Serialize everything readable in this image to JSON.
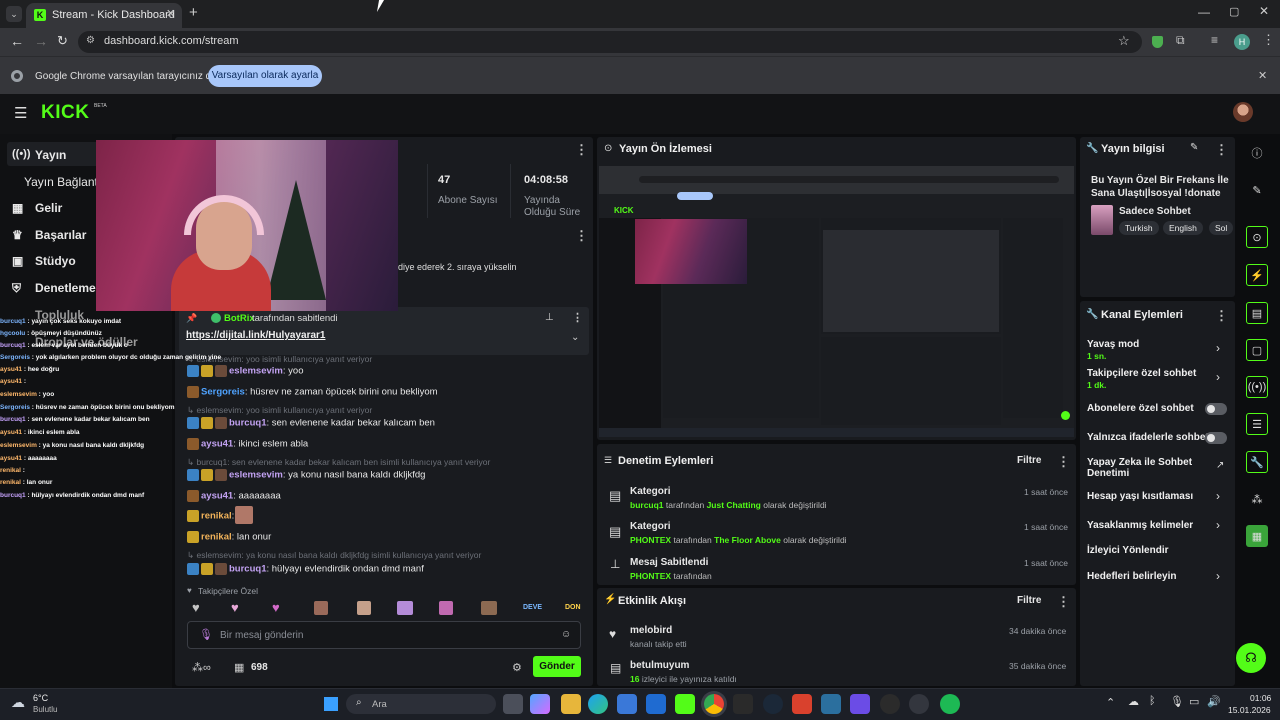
{
  "browser": {
    "tab_title": "Stream - Kick Dashboard",
    "url": "dashboard.kick.com/stream",
    "profile_letter": "H",
    "infobar_text": "Google Chrome varsayılan tarayıcınız değil",
    "infobar_button": "Varsayılan olarak ayarla"
  },
  "site": {
    "logo": "KICK",
    "logo_sup": "BETA"
  },
  "nav": {
    "items": [
      "Yayın",
      "Yayın Bağlantı",
      "Gelir",
      "Başarılar",
      "Stüdyo",
      "Denetleme",
      "Topluluk",
      "Droplar ve ödüller"
    ]
  },
  "stats": {
    "subs_value": "47",
    "subs_label": "Abone Sayısı",
    "uptime_value": "04:08:58",
    "uptime_label": "Yayında Olduğu Süre"
  },
  "chat": {
    "truncated_top": "diye ederek 2. sıraya yükselin",
    "pinned_by_user": "BotRix",
    "pinned_by_suffix": "tarafından sabitlendi",
    "pinned_link": "https://dijital.link/Hulyayarar1",
    "messages": [
      {
        "reply": "eslemsevim: yoo isimli kullanıcıya yanıt veriyor",
        "user": "eslemsevim",
        "text": "yoo"
      },
      {
        "reply": "",
        "user": "Sergoreis",
        "text": "hüsrev ne zaman öpücek birini onu bekliyom"
      },
      {
        "reply": "eslemsevim: yoo isimli kullanıcıya yanıt veriyor",
        "user": "burcuq1",
        "text": "sen evlenene kadar bekar kalıcam ben"
      },
      {
        "reply": "",
        "user": "aysu41",
        "text": "ikinci eslem abla"
      },
      {
        "reply": "burcuq1: sen evlenene kadar bekar kalıcam ben isimli kullanıcıya yanıt veriyor",
        "user": "eslemsevim",
        "text": "ya konu nasıl bana kaldı dkljkfdg"
      },
      {
        "reply": "",
        "user": "aysu41",
        "text": "aaaaaaaa"
      },
      {
        "reply": "",
        "user": "renikal",
        "text": ""
      },
      {
        "reply": "",
        "user": "renikal",
        "text": "lan onur"
      },
      {
        "reply": "eslemsevim: ya konu nasıl bana kaldı dkljkfdg isimli kullanıcıya yanıt veriyor",
        "user": "burcuq1",
        "text": "hülyayı evlendirdik ondan dmd manf"
      }
    ],
    "followers_only": "Takipçilere Özel",
    "emote_labels": [
      "DEVE",
      "DON"
    ],
    "input_placeholder": "Bir mesaj gönderin",
    "viewer_count": "698",
    "send_label": "Gönder"
  },
  "overlay_chat": [
    {
      "user": "burcuq1",
      "text": "yayın çok seks kokuyo imdat"
    },
    {
      "user": "hgcoolu",
      "text": "öpüşmeyi düşündünüz"
    },
    {
      "user": "burcuq1",
      "text": "eslem var ayol benden büyük o"
    },
    {
      "user": "Sergoreis",
      "text": "yok algılarken problem oluyor dc olduğu zaman gelirim yine"
    },
    {
      "user": "aysu41",
      "text": "hee doğru"
    },
    {
      "user": "aysu41",
      "text": ""
    },
    {
      "user": "eslemsevim",
      "text": "yoo"
    },
    {
      "user": "Sergoreis",
      "text": "hüsrev ne zaman öpücek birini onu bekliyom"
    },
    {
      "user": "burcuq1",
      "text": "sen evlenene kadar bekar kalıcam ben"
    },
    {
      "user": "aysu41",
      "text": "ikinci eslem abla"
    },
    {
      "user": "eslemsevim",
      "text": "ya konu nasıl bana kaldı dkljkfdg"
    },
    {
      "user": "aysu41",
      "text": "aaaaaaaa"
    },
    {
      "user": "renikal",
      "text": ""
    },
    {
      "user": "renikal",
      "text": "lan onur"
    },
    {
      "user": "burcuq1",
      "text": "hülyayı evlendirdik ondan dmd manf"
    }
  ],
  "preview": {
    "title": "Yayın Ön İzlemesi"
  },
  "moderation": {
    "title": "Denetim Eylemleri",
    "filter": "Filtre",
    "rows": [
      {
        "title": "Kategori",
        "actor": "burcuq1",
        "mid": "tarafından",
        "target": "Just Chatting",
        "end": "olarak değiştirildi",
        "time": "1 saat önce"
      },
      {
        "title": "Kategori",
        "actor": "PHONTEX",
        "mid": "tarafından",
        "target": "The Floor Above",
        "end": "olarak değiştirildi",
        "time": "1 saat önce"
      },
      {
        "title": "Mesaj Sabitlendi",
        "actor": "PHONTEX",
        "mid": "tarafından",
        "target": "",
        "end": "",
        "time": "1 saat önce"
      }
    ]
  },
  "activity": {
    "title": "Etkinlik Akışı",
    "filter": "Filtre",
    "rows": [
      {
        "user": "melobird",
        "text": "kanalı takip etti",
        "time": "34 dakika önce"
      },
      {
        "user": "betulmuyum",
        "text": "izleyici ile yayınıza katıldı",
        "count": "16",
        "time": "35 dakika önce"
      }
    ]
  },
  "stream_info": {
    "title": "Yayın bilgisi",
    "stream_title": "Bu Yayın Özel Bir Frekans İle Sana Ulaştı|İsosyal !donate",
    "category": "Sadece Sohbet",
    "tags": [
      "Turkish",
      "English",
      "Sol"
    ]
  },
  "channel_actions": {
    "title": "Kanal Eylemleri",
    "slow_mode": "Yavaş mod",
    "slow_mode_value": "1 sn.",
    "followers_chat": "Takipçilere özel sohbet",
    "followers_chat_value": "1 dk.",
    "subs_chat": "Abonelere özel sohbet",
    "emotes_chat": "Yalnızca ifadelerle sohbet",
    "ai_mod": "Yapay Zeka ile Sohbet Denetimi",
    "age_limit": "Hesap yaşı kısıtlaması",
    "banned_words": "Yasaklanmış kelimeler",
    "raid": "İzleyici Yönlendir",
    "goals": "Hedefleri belirleyin"
  },
  "taskbar": {
    "temp": "6°C",
    "weather": "Bulutlu",
    "search": "Ara",
    "time": "01:06",
    "date": "15.01.2026"
  },
  "colors": {
    "kick_green": "#53fc18",
    "panel": "#191b1f",
    "page_bg": "#0c0d0f",
    "chrome_dark": "#1f2022",
    "chrome_mid": "#35363a"
  }
}
